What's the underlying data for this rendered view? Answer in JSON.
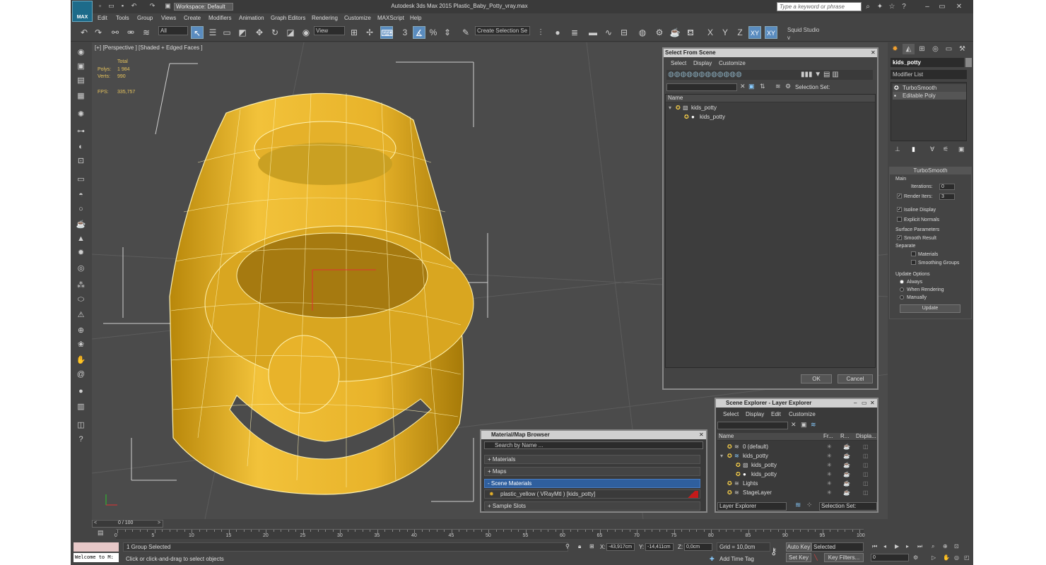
{
  "titlebar": {
    "workspace": "Workspace: Default",
    "title": "Autodesk 3ds Max  2015     Plastic_Baby_Potty_vray.max",
    "search_placeholder": "Type a keyword or phrase",
    "logo": "MAX"
  },
  "menus": [
    "Edit",
    "Tools",
    "Group",
    "Views",
    "Create",
    "Modifiers",
    "Animation",
    "Graph Editors",
    "Rendering",
    "Customize",
    "MAXScript",
    "Help"
  ],
  "toolbar": {
    "filter": "All",
    "refcoord": "View",
    "selection_set": "Create Selection Se",
    "axis_x": "X",
    "axis_y": "Y",
    "axis_z": "Z",
    "axis_xy": "XY",
    "axis_xy2": "XY",
    "squid": "Squid Studio v"
  },
  "viewport": {
    "label": "[+] [Perspective ] [Shaded + Edged Faces ]",
    "stats": {
      "total": "Total",
      "polys_label": "Polys:",
      "polys": "1 984",
      "verts_label": "Verts:",
      "verts": "990",
      "fps_label": "FPS:",
      "fps": "335,757"
    }
  },
  "command_panel": {
    "object_name": "kids_potty",
    "modifier_list": "Modifier List",
    "stack": [
      "TurboSmooth",
      "Editable Poly"
    ],
    "turbosmooth": {
      "title": "TurboSmooth",
      "main": "Main",
      "iterations_label": "Iterations:",
      "iterations": "0",
      "render_iters_label": "Render Iters:",
      "render_iters": "3",
      "isoline": "Isoline Display",
      "explicit": "Explicit Normals",
      "surface": "Surface Parameters",
      "smooth_result": "Smooth Result",
      "separate": "Separate",
      "materials": "Materials",
      "smoothing_groups": "Smoothing Groups",
      "update_options": "Update Options",
      "always": "Always",
      "when_rendering": "When Rendering",
      "manually": "Manually",
      "update": "Update"
    }
  },
  "select_from_scene": {
    "title": "Select From Scene",
    "menus": [
      "Select",
      "Display",
      "Customize"
    ],
    "selection_set": "Selection Set:",
    "col_name": "Name",
    "items": [
      "kids_potty",
      "kids_potty"
    ],
    "ok": "OK",
    "cancel": "Cancel"
  },
  "material_browser": {
    "title": "Material/Map Browser",
    "search": "Search by Name ...",
    "materials": "+ Materials",
    "maps": "+ Maps",
    "scene_materials": "- Scene Materials",
    "material_item": "plastic_yellow  ( VRayMtl )  [kids_potty]",
    "sample_slots": "+ Sample Slots"
  },
  "scene_explorer": {
    "title": "Scene Explorer - Layer Explorer",
    "menus": [
      "Select",
      "Display",
      "Edit",
      "Customize"
    ],
    "cols": [
      "Name",
      "Fr...",
      "R...",
      "Displa..."
    ],
    "rows": [
      "0 (default)",
      "kids_potty",
      "kids_potty",
      "kids_potty",
      "Lights",
      "StageLayer"
    ],
    "footer_left": "Layer Explorer",
    "footer_right": "Selection Set:"
  },
  "timeline": {
    "frame": "0 / 100",
    "ticks": [
      "0",
      "5",
      "10",
      "15",
      "20",
      "25",
      "30",
      "35",
      "40",
      "45",
      "50",
      "55",
      "60",
      "65",
      "70",
      "75",
      "80",
      "85",
      "90",
      "95",
      "100"
    ]
  },
  "status": {
    "maxscript": "Welcome to M:",
    "selected": "1 Group Selected",
    "prompt": "Click or click-and-drag to select objects",
    "x_label": "X:",
    "x": "-43,917cm",
    "y_label": "Y:",
    "y": "-14,411cm",
    "z_label": "Z:",
    "z": "0,0cm",
    "grid": "Grid = 10,0cm",
    "add_time_tag": "Add Time Tag",
    "auto_key": "Auto Key",
    "set_key": "Set Key",
    "selected_dd": "Selected",
    "key_filters": "Key Filters...",
    "frame_field": "0"
  }
}
